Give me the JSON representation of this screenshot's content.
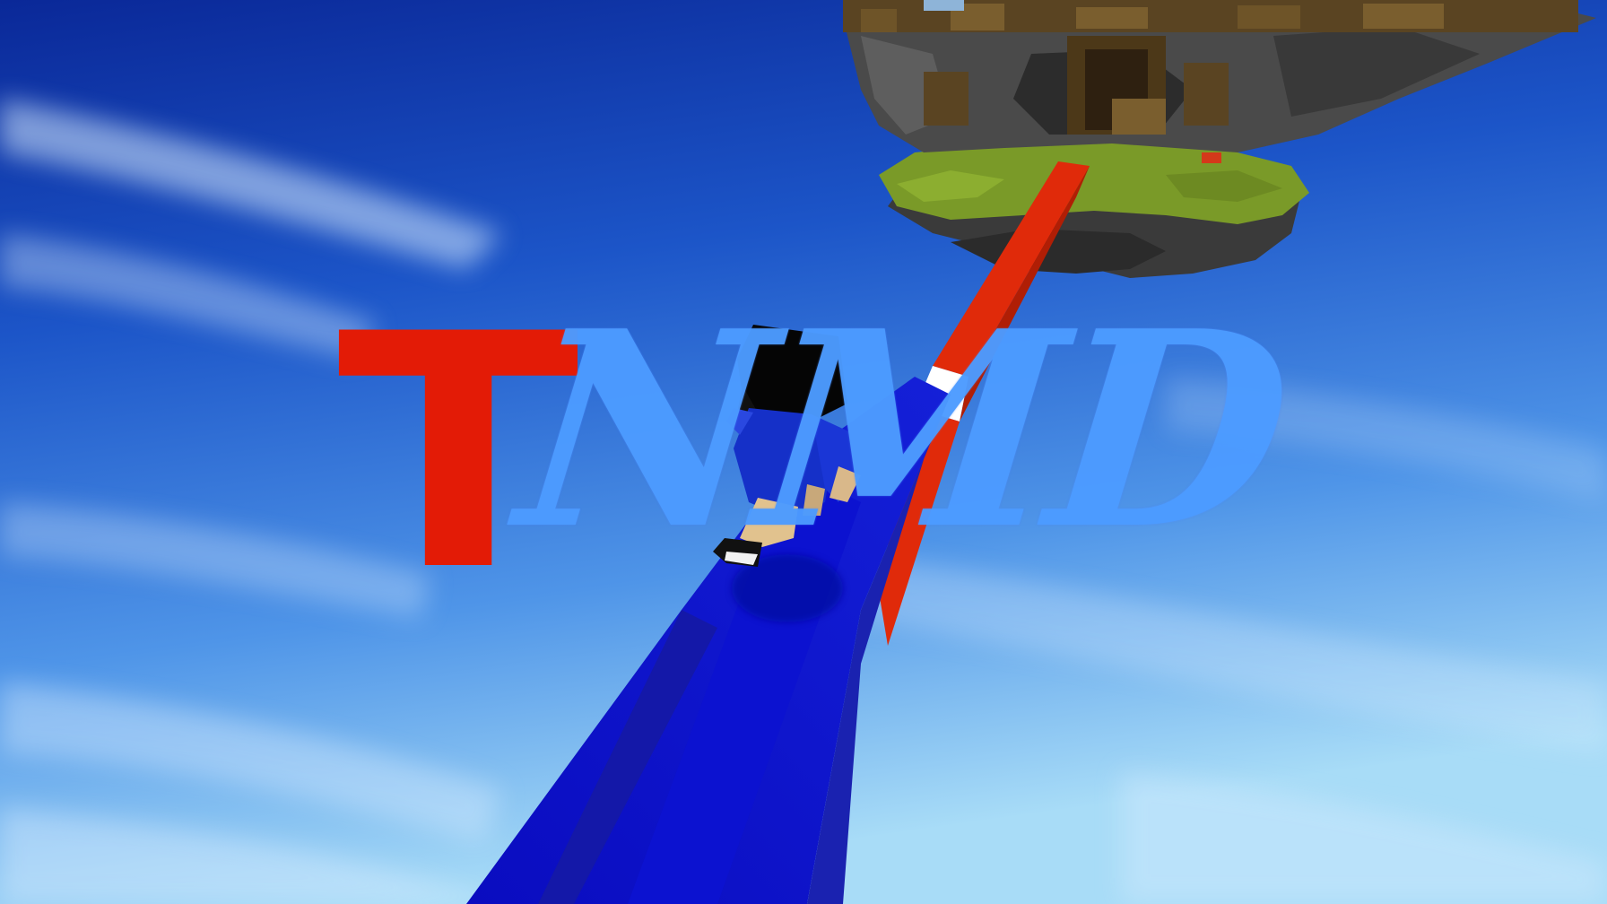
{
  "logo": {
    "red_text": "T",
    "blue_text": "NMD",
    "red_color": "#e31b06",
    "blue_color": "#4d9bff"
  },
  "colors": {
    "sky_top": "#0a2a9e",
    "sky_mid": "#2a6fd9",
    "sky_bottom": "#9fd6f5",
    "bridge_blue": "#0a10c8",
    "bridge_red": "#e02a0a",
    "grass": "#7d9a2a",
    "stone": "#3c3c3c",
    "wood": "#5a4422"
  },
  "scene": {
    "player": "player-skin-icon",
    "bridge": "bridge-icon",
    "island": "sky-island-icon",
    "clouds": "cloud-icon"
  }
}
